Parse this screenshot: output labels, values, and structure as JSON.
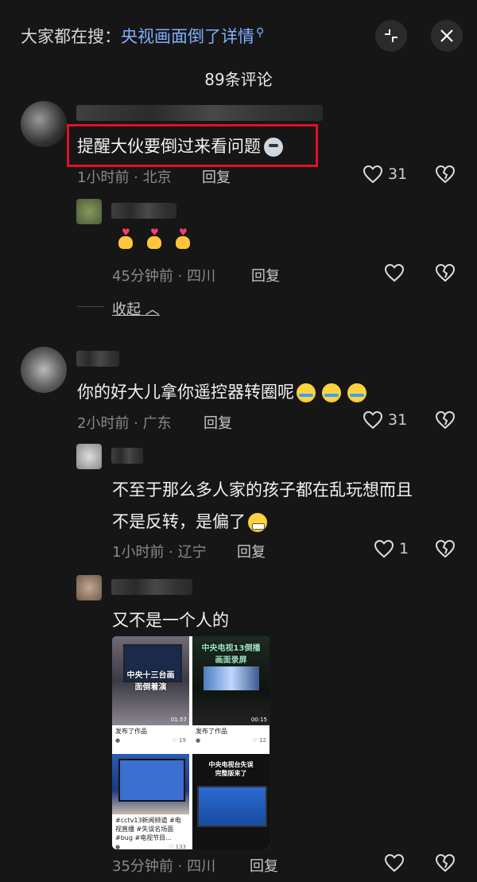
{
  "header": {
    "prefix": "大家都在搜：",
    "query": "央视画面倒了详情",
    "comment_count": "89条评论"
  },
  "comments": [
    {
      "text": "提醒大伙要倒过来看问题",
      "time_loc": "1小时前 · 北京",
      "reply_label": "回复",
      "likes": "31",
      "replies": [
        {
          "time_loc": "45分钟前 · 四川",
          "reply_label": "回复"
        }
      ],
      "collapse_label": "收起"
    },
    {
      "text": "你的好大儿拿你遥控器转圈呢",
      "time_loc": "2小时前 · 广东",
      "reply_label": "回复",
      "likes": "31",
      "replies": [
        {
          "text_line1": "不至于那么多人家的孩子都在乱玩想而且",
          "text_line2": "不是反转，是偏了",
          "time_loc": "1小时前 · 辽宁",
          "reply_label": "回复",
          "likes": "1"
        },
        {
          "text": "又不是一个人的",
          "time_loc": "35分钟前 · 四川",
          "reply_label": "回复",
          "thumbs": [
            {
              "overlay": "中央十三台画\n面倒着演",
              "caption": "发布了作品",
              "duration": "01:57",
              "likes": "19"
            },
            {
              "overlay": "中央电视13倒播\n画面录屏",
              "caption": "发布了作品",
              "duration": "00:15",
              "likes": "12"
            },
            {
              "overlay": "",
              "caption": "#cctv13新闻频道 #电视直播 #失误名场面 #bug #电视节目...",
              "duration": "",
              "likes": "133"
            },
            {
              "overlay": "中央电视台失误\n完整版来了",
              "caption": "",
              "duration": "",
              "likes": ""
            }
          ]
        }
      ]
    }
  ]
}
